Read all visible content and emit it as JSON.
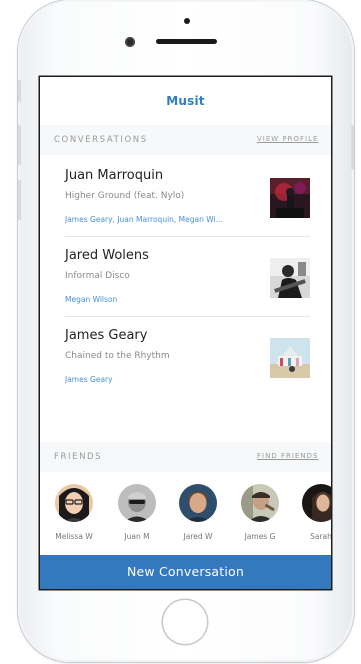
{
  "app": {
    "title": "Musit"
  },
  "colors": {
    "accent": "#2f7ec2",
    "button": "#3478bd",
    "members": "#4a90d9"
  },
  "conversations_section": {
    "label": "CONVERSATIONS",
    "link": "VIEW PROFILE"
  },
  "conversations": [
    {
      "name": "Juan Marroquin",
      "song": "Higher Ground (feat. Nylo)",
      "members": "James Geary, Juan Marroquin, Megan Wi...",
      "thumbnail": "album-art-concert-icon"
    },
    {
      "name": "Jared Wolens",
      "song": "Informal Disco",
      "members": "Megan Wilson",
      "thumbnail": "album-art-guitarist-icon"
    },
    {
      "name": "James Geary",
      "song": "Chained to the Rhythm",
      "members": "James Geary",
      "thumbnail": "album-art-carousel-icon"
    }
  ],
  "friends_section": {
    "label": "FRIENDS",
    "link": "FIND FRIENDS"
  },
  "friends": [
    {
      "name": "Melissa W"
    },
    {
      "name": "Juan M"
    },
    {
      "name": "Jared W"
    },
    {
      "name": "James G"
    },
    {
      "name": "Sarah"
    }
  ],
  "footer": {
    "button_label": "New Conversation"
  }
}
